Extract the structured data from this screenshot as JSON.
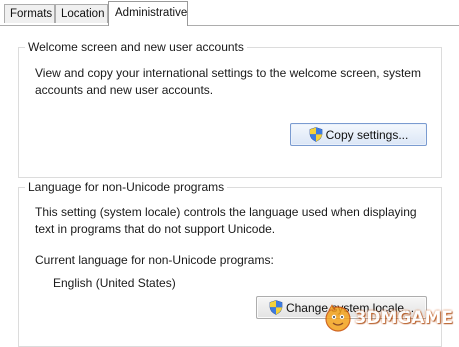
{
  "tabs": [
    {
      "label": "Formats"
    },
    {
      "label": "Location"
    },
    {
      "label": "Administrative",
      "active": true
    }
  ],
  "welcome_group": {
    "title": "Welcome screen and new user accounts",
    "description_line1": "View and copy your international settings to the welcome screen, system",
    "description_line2": "accounts and new user accounts.",
    "button_label": "Copy settings..."
  },
  "unicode_group": {
    "title": "Language for non-Unicode programs",
    "description_line1": "This setting (system locale) controls the language used when displaying",
    "description_line2": "text in programs that do not support Unicode.",
    "current_label": "Current language for non-Unicode programs:",
    "current_value": "English (United States)",
    "button_label": "Change system locale..."
  },
  "icons": {
    "shield": "uac-shield-icon"
  },
  "watermark": {
    "text": "3DMGAME"
  }
}
